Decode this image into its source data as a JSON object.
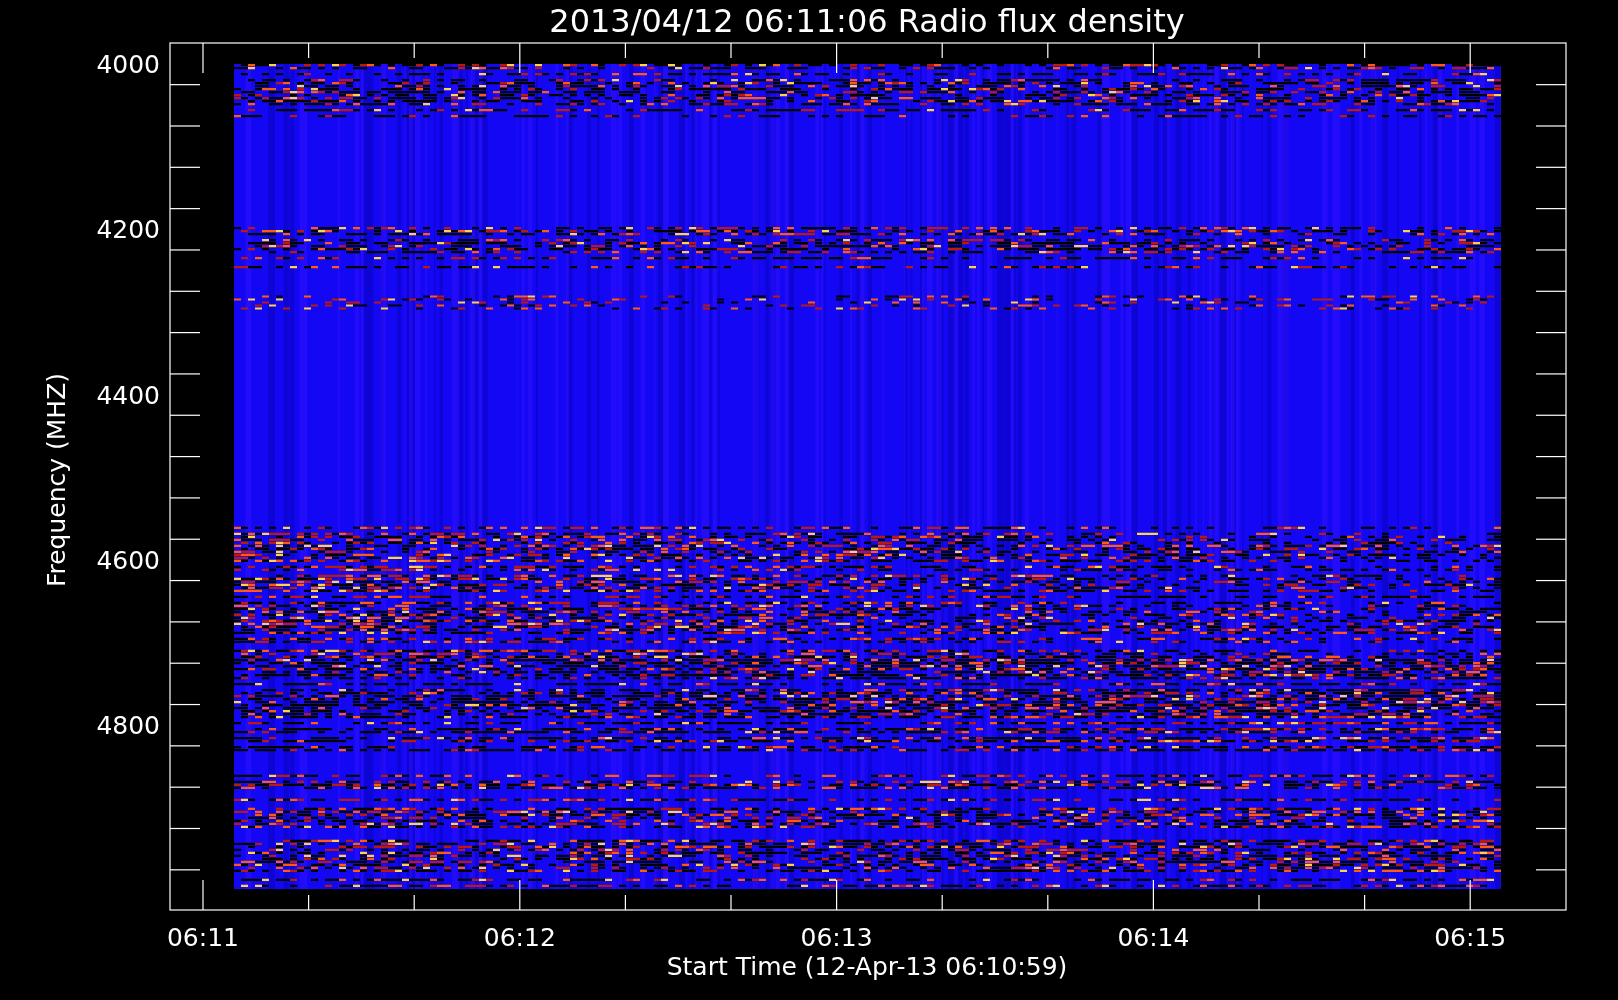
{
  "title": "2013/04/12 06:11:06 Radio flux density",
  "y_axis": {
    "label": "Frequency (MHZ)",
    "ticks": [
      "4000",
      "4200",
      "4400",
      "4600",
      "4800"
    ]
  },
  "x_axis": {
    "label": "Start Time (12-Apr-13 06:10:59)",
    "ticks": [
      "06:11",
      "06:12",
      "06:13",
      "06:14",
      "06:15"
    ]
  }
}
